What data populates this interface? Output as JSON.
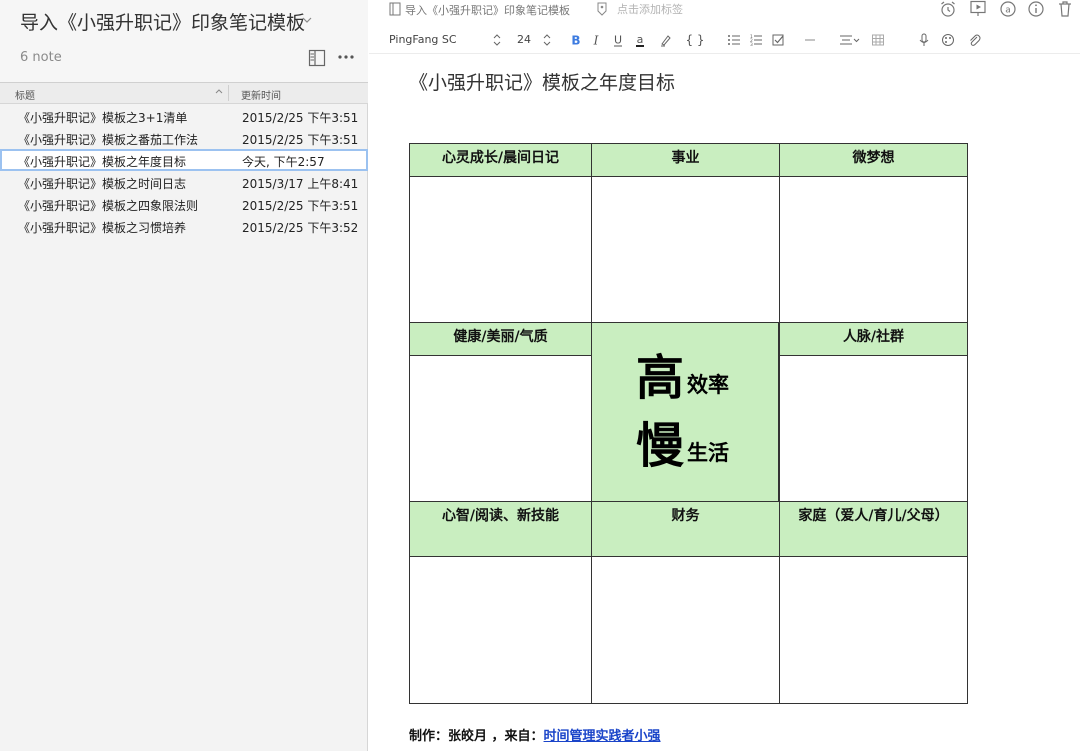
{
  "list_pane": {
    "notebook_title": "导入《小强升职记》印象笔记模板",
    "note_count": "6 note",
    "columns": {
      "title": "标题",
      "updated": "更新时间"
    },
    "notes": [
      {
        "title": "《小强升职记》模板之3+1清单",
        "updated": "2015/2/25 下午3:51"
      },
      {
        "title": "《小强升职记》模板之番茄工作法",
        "updated": "2015/2/25 下午3:51"
      },
      {
        "title": "《小强升职记》模板之年度目标",
        "updated": "今天, 下午2:57"
      },
      {
        "title": "《小强升职记》模板之时间日志",
        "updated": "2015/3/17 上午8:41"
      },
      {
        "title": "《小强升职记》模板之四象限法则",
        "updated": "2015/2/25 下午3:51"
      },
      {
        "title": "《小强升职记》模板之习惯培养",
        "updated": "2015/2/25 下午3:52"
      }
    ],
    "selected_index": 2
  },
  "editor": {
    "notebook_path": "导入《小强升职记》印象笔记模板",
    "tag_placeholder": "点击添加标签",
    "font_name": "PingFang SC",
    "font_size": "24",
    "code_label": "{ }",
    "doc_title": "《小强升职记》模板之年度目标"
  },
  "template": {
    "headers": {
      "mind": "心灵成长/晨间日记",
      "career": "事业",
      "dream": "微梦想",
      "health": "健康/美丽/气质",
      "network": "人脉/社群",
      "intellect": "心智/阅读、新技能",
      "finance": "财务",
      "family": "家庭（爱人/育儿/父母）"
    },
    "center": {
      "big1": "高",
      "small1": "效率",
      "big2": "慢",
      "small2": "生活"
    },
    "header_color": "#c9eec0"
  },
  "footer": {
    "prefix": "制作：张皎月 ，来自：",
    "link": "时间管理实践者小强"
  },
  "colors": {
    "link": "#1a44c9",
    "selection": "#9cc2f0"
  }
}
